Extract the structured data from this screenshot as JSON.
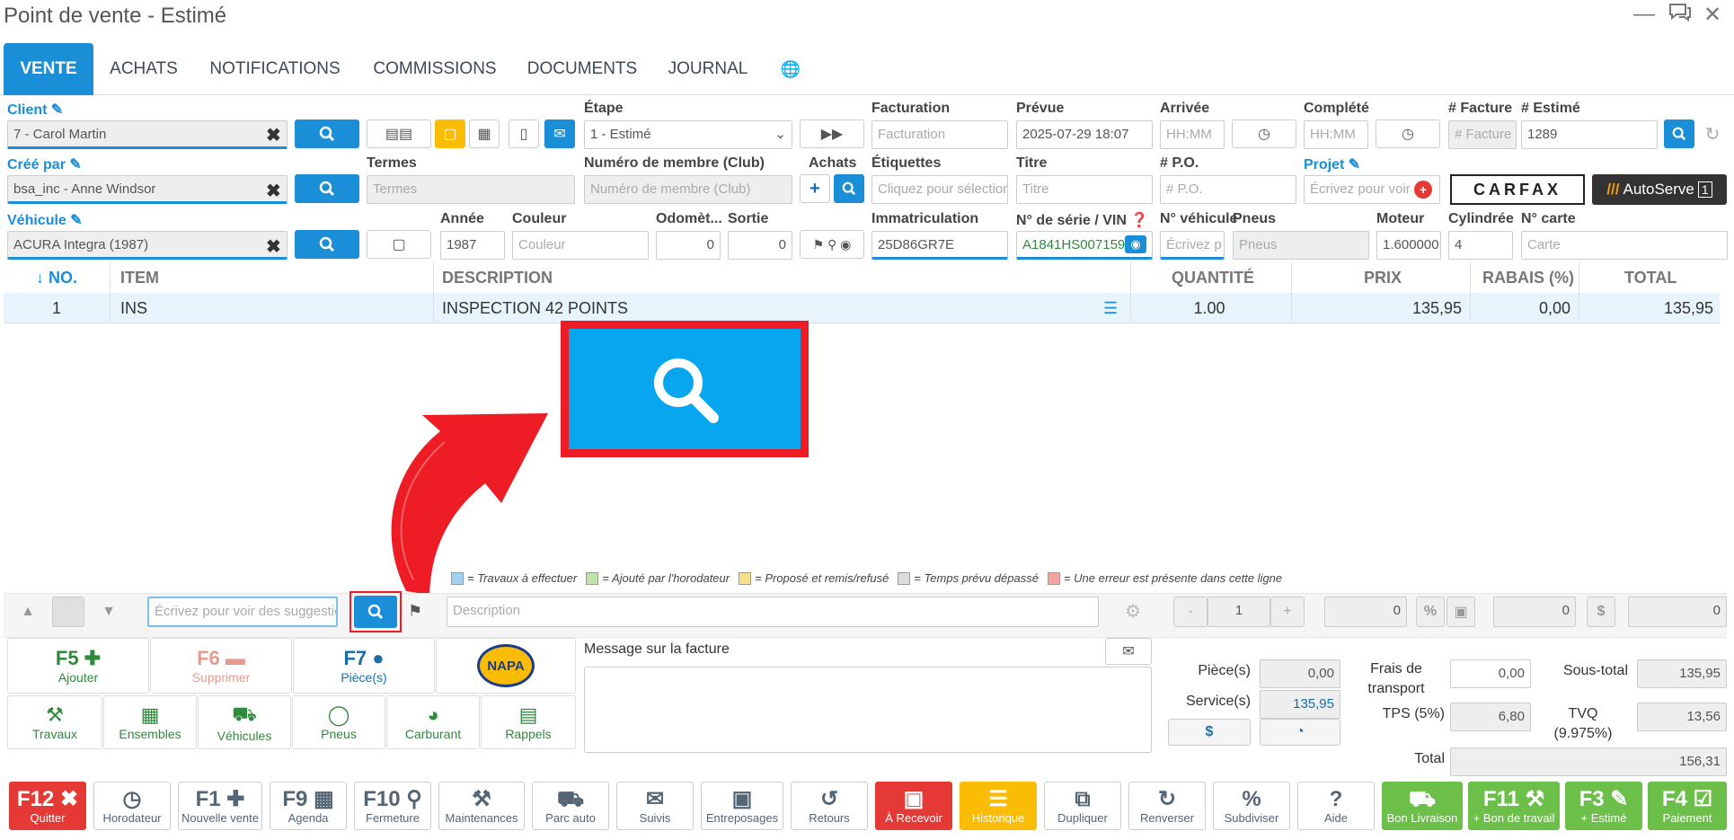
{
  "window": {
    "title": "Point de vente - Estimé",
    "min": "—",
    "chat": "💬",
    "close": "✕"
  },
  "tabs": [
    {
      "label": "VENTE"
    },
    {
      "label": "ACHATS"
    },
    {
      "label": "NOTIFICATIONS"
    },
    {
      "label": "COMMISSIONS"
    },
    {
      "label": "DOCUMENTS"
    },
    {
      "label": "JOURNAL"
    }
  ],
  "globe": "🌐",
  "form": {
    "client_label": "Client",
    "client_value": "7 - Carol Martin",
    "etape_label": "Étape",
    "etape_value": "1 - Estimé",
    "facturation_label": "Facturation",
    "facturation_ph": "Facturation",
    "prevue_label": "Prévue",
    "prevue_value": "2025-07-29 18:07",
    "arrivee_label": "Arrivée",
    "arrivee_ph": "HH:MM",
    "complete_label": "Complété",
    "complete_ph": "HH:MM",
    "facture_label": "# Facture",
    "facture_ph": "# Facture",
    "estime_label": "# Estimé",
    "estime_value": "1289",
    "cree_label": "Créé par",
    "cree_value": "bsa_inc - Anne Windsor",
    "termes_label": "Termes",
    "termes_ph": "Termes",
    "membre_label": "Numéro de membre (Club)",
    "membre_ph": "Numéro de membre (Club)",
    "achats_label": "Achats",
    "etiquettes_label": "Étiquettes",
    "etiquettes_ph": "Cliquez pour sélectionner",
    "titre_label": "Titre",
    "titre_ph": "Titre",
    "po_label": "# P.O.",
    "po_ph": "# P.O.",
    "projet_label": "Projet",
    "projet_ph": "Écrivez pour voir",
    "carfax": "CARFAX",
    "autoserve": "AutoServe",
    "vehicule_label": "Véhicule",
    "vehicule_value": "ACURA Integra (1987)",
    "annee_label": "Année",
    "annee_value": "1987",
    "couleur_label": "Couleur",
    "couleur_ph": "Couleur",
    "odometre_label": "Odomèt...",
    "odometre_value": "0",
    "sortie_label": "Sortie",
    "sortie_value": "0",
    "immat_label": "Immatriculation",
    "immat_value": "25D86GR7E",
    "vin_label": "N° de série / VIN",
    "vin_value": "A1841HS007159",
    "novehicule_label": "N° véhicule",
    "novehicule_ph": "Écrivez p",
    "pneus_label": "Pneus",
    "pneus_ph": "Pneus",
    "moteur_label": "Moteur",
    "moteur_value": "1.600000",
    "cylindree_label": "Cylindrée",
    "cylindree_value": "4",
    "carte_label": "N° carte",
    "carte_ph": "Carte"
  },
  "table": {
    "headers": {
      "no": "↓ NO.",
      "item": "ITEM",
      "description": "DESCRIPTION",
      "quantite": "QUANTITÉ",
      "prix": "PRIX",
      "rabais": "RABAIS (%)",
      "total": "TOTAL"
    },
    "rows": [
      {
        "no": "1",
        "item": "INS",
        "description": "INSPECTION 42 POINTS",
        "quantite": "1.00",
        "prix": "135,95",
        "rabais": "0,00",
        "total": "135,95"
      }
    ]
  },
  "legend": {
    "l1": "= Travaux à effectuer",
    "l2": "= Ajouté par l'horodateur",
    "l3": "= Proposé et remis/refusé",
    "l4": "= Temps prévu dépassé",
    "l5": "= Une erreur est présente dans cette ligne",
    "c1": "#9fd3f5",
    "c2": "#bfe3a8",
    "c3": "#f8e08a",
    "c4": "#dddddd",
    "c5": "#f4a3a3"
  },
  "entry": {
    "search_ph": "Écrivez pour voir des suggestions",
    "description_ph": "Description",
    "qty": "1",
    "v1": "0",
    "v2": "0",
    "v3": "0",
    "minus": "-",
    "plus": "+"
  },
  "tiles": {
    "f5": "F5",
    "f5s": "Ajouter",
    "f6": "F6",
    "f6s": "Supprimer",
    "f7": "F7",
    "f7s": "Pièce(s)",
    "napa": "NAPA",
    "travaux": "Travaux",
    "ensembles": "Ensembles",
    "vehicules": "Véhicules",
    "pneus": "Pneus",
    "carburant": "Carburant",
    "rappels": "Rappels"
  },
  "message": {
    "label": "Message sur la facture"
  },
  "totals": {
    "pieces_label": "Pièce(s)",
    "pieces": "0,00",
    "service_label": "Service(s)",
    "service": "135,95",
    "frais_label": "Frais de transport",
    "frais": "0,00",
    "tps_label": "TPS (5%)",
    "tps": "6,80",
    "sous_label": "Sous-total",
    "sous": "135,95",
    "tvq_label": "TVQ (9.975%)",
    "tvq": "13,56",
    "total_label": "Total",
    "total": "156,31"
  },
  "footer": [
    {
      "k": "F12",
      "s": "Quitter"
    },
    {
      "k": "",
      "s": "Horodateur"
    },
    {
      "k": "F1",
      "s": "Nouvelle vente"
    },
    {
      "k": "F9",
      "s": "Agenda"
    },
    {
      "k": "F10",
      "s": "Fermeture"
    },
    {
      "k": "",
      "s": "Maintenances"
    },
    {
      "k": "",
      "s": "Parc auto"
    },
    {
      "k": "",
      "s": "Suivis"
    },
    {
      "k": "",
      "s": "Entreposages"
    },
    {
      "k": "",
      "s": "Retours"
    },
    {
      "k": "",
      "s": "À Recevoir"
    },
    {
      "k": "",
      "s": "Historique"
    },
    {
      "k": "",
      "s": "Dupliquer"
    },
    {
      "k": "",
      "s": "Renverser"
    },
    {
      "k": "",
      "s": "Subdiviser"
    },
    {
      "k": "",
      "s": "Aide"
    },
    {
      "k": "",
      "s": "Bon Livraison"
    },
    {
      "k": "F11",
      "s": "+ Bon de travail"
    },
    {
      "k": "F3",
      "s": "+ Estimé"
    },
    {
      "k": "F4",
      "s": "Paiement"
    }
  ],
  "colors": {
    "primary": "#1a8fd8",
    "green": "#6cc04a",
    "red": "#e53935",
    "orange": "#fbbc05",
    "annotation_red": "#ee1c25"
  }
}
